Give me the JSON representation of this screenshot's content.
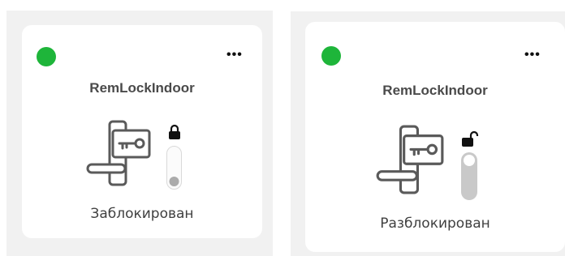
{
  "colors": {
    "status_online": "#1eb53a",
    "icon_stroke": "#5a5a5a",
    "toggle_track": "#ececec",
    "toggle_track_on": "#c9c9c9",
    "knob": "#ababab",
    "panel_bg": "#f1f1f1"
  },
  "cards": [
    {
      "device_name": "RemLockIndoor",
      "state_label": "Заблокирован",
      "status_icon": "status-dot-green",
      "lock_icon": "padlock-closed-icon",
      "locked": true
    },
    {
      "device_name": "RemLockIndoor",
      "state_label": "Разблокирован",
      "status_icon": "status-dot-green",
      "lock_icon": "padlock-open-icon",
      "locked": false
    }
  ]
}
